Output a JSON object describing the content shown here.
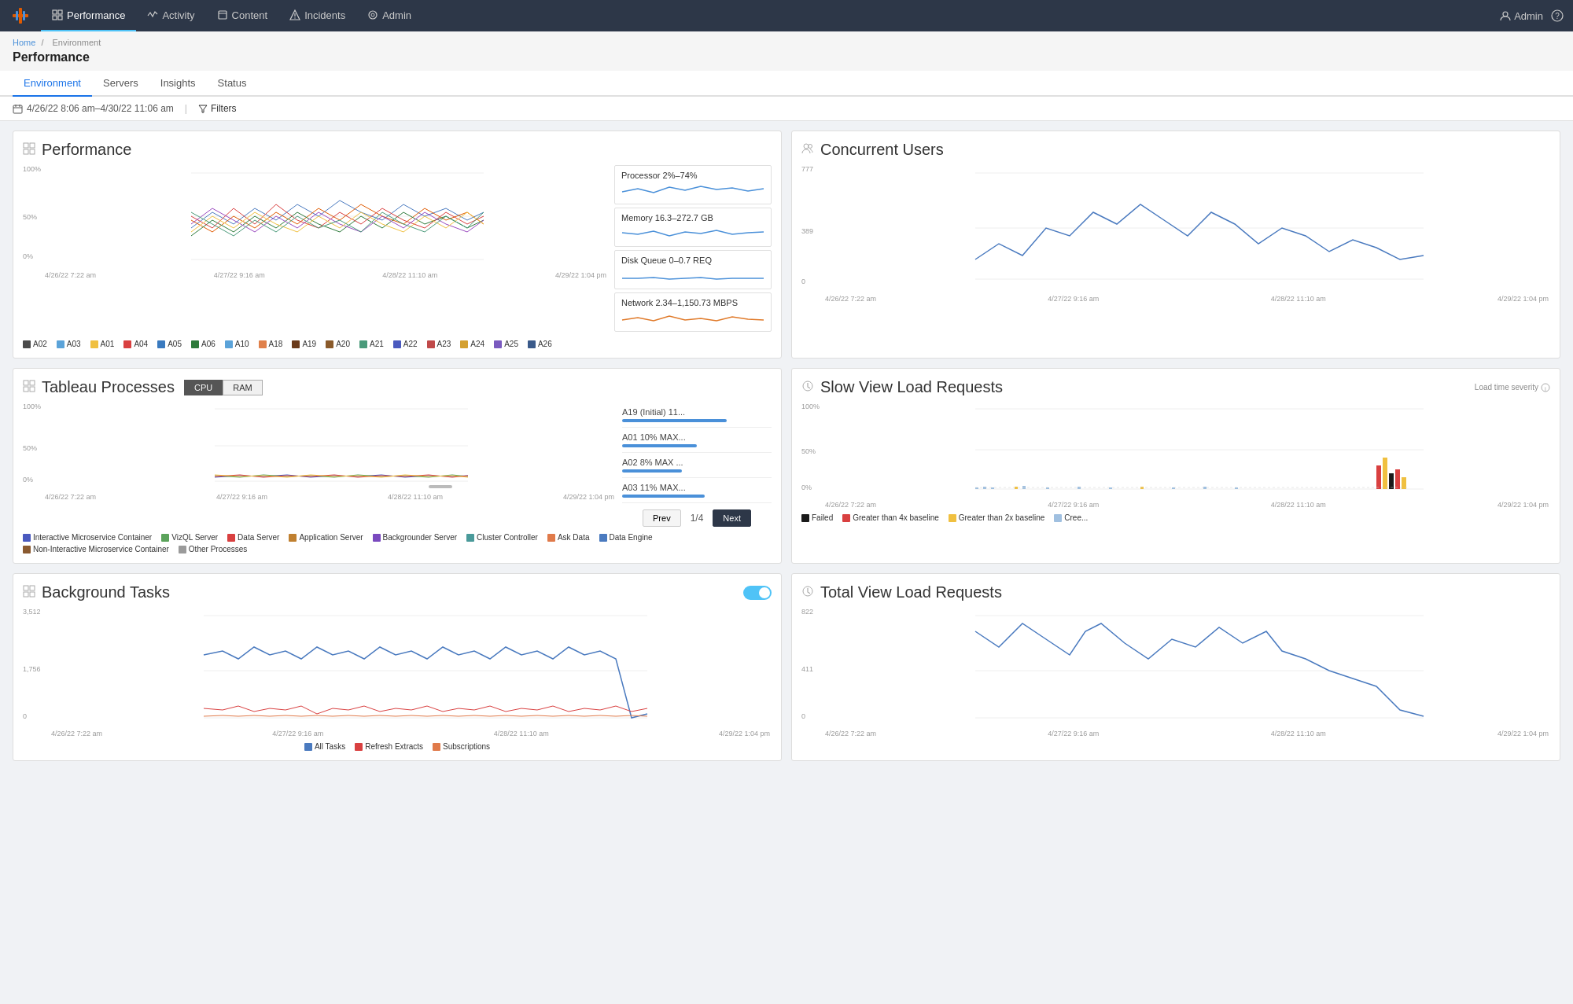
{
  "nav": {
    "logo_label": "Tableau",
    "items": [
      {
        "label": "Performance",
        "icon": "grid",
        "active": true
      },
      {
        "label": "Activity",
        "icon": "activity",
        "active": false
      },
      {
        "label": "Content",
        "icon": "content",
        "active": false
      },
      {
        "label": "Incidents",
        "icon": "alert",
        "active": false
      },
      {
        "label": "Admin",
        "icon": "gear",
        "active": false
      }
    ],
    "admin_label": "Admin",
    "help_icon": "?"
  },
  "breadcrumb": {
    "home": "Home",
    "separator": "/",
    "current": "Environment"
  },
  "page_title": "Performance",
  "tabs": [
    {
      "label": "Environment",
      "active": true
    },
    {
      "label": "Servers",
      "active": false
    },
    {
      "label": "Insights",
      "active": false
    },
    {
      "label": "Status",
      "active": false
    }
  ],
  "toolbar": {
    "date_range": "4/26/22 8:06 am–4/30/22 11:06 am",
    "divider": "|",
    "filter_label": "Filters"
  },
  "performance_card": {
    "title": "Performance",
    "y_labels": [
      "100%",
      "50%",
      "0%"
    ],
    "x_labels": [
      "4/26/22 7:22 am",
      "4/27/22 9:16 am",
      "4/28/22 11:10 am",
      "4/29/22 1:04 pm"
    ],
    "legend": [
      {
        "label": "A02",
        "color": "#4a4a4a"
      },
      {
        "label": "A03",
        "color": "#5ba3d9"
      },
      {
        "label": "A01",
        "color": "#f0c040"
      },
      {
        "label": "A04",
        "color": "#d94040"
      },
      {
        "label": "A05",
        "color": "#3a7abf"
      },
      {
        "label": "A06",
        "color": "#2d7a3a"
      },
      {
        "label": "A10",
        "color": "#5ba3d9"
      },
      {
        "label": "A18",
        "color": "#e0804a"
      },
      {
        "label": "A19",
        "color": "#6a3a1a"
      },
      {
        "label": "A20",
        "color": "#8a5a2a"
      },
      {
        "label": "A21",
        "color": "#4a9a7a"
      },
      {
        "label": "A22",
        "color": "#4a5abf"
      },
      {
        "label": "A23",
        "color": "#c04a4a"
      },
      {
        "label": "A24",
        "color": "#d4a030"
      },
      {
        "label": "A25",
        "color": "#7a5abf"
      },
      {
        "label": "A26",
        "color": "#3a5a8a"
      }
    ],
    "metrics": [
      {
        "label": "Processor 2%–74%",
        "color": "#4a90d9"
      },
      {
        "label": "Memory 16.3–272.7 GB",
        "color": "#4a90d9"
      },
      {
        "label": "Disk Queue 0–0.7 REQ",
        "color": "#4a90d9"
      },
      {
        "label": "Network 2.34–1,150.73 MBPS",
        "color": "#e07a2a"
      }
    ]
  },
  "concurrent_users_card": {
    "title": "Concurrent Users",
    "y_labels": [
      "777",
      "389",
      "0"
    ],
    "x_labels": [
      "4/26/22 7:22 am",
      "4/27/22 9:16 am",
      "4/28/22 11:10 am",
      "4/29/22 1:04 pm"
    ]
  },
  "tableau_processes_card": {
    "title": "Tableau Processes",
    "cpu_label": "CPU",
    "ram_label": "RAM",
    "y_labels": [
      "100%",
      "50%",
      "0%"
    ],
    "x_labels": [
      "4/26/22 7:22 am",
      "4/27/22 9:16 am",
      "4/28/22 11:10 am",
      "4/29/22 1:04 pm"
    ],
    "process_items": [
      {
        "label": "A19 (Initial) 11...",
        "pct": 70
      },
      {
        "label": "A01 10% MAX...",
        "pct": 50
      },
      {
        "label": "A02 8% MAX ...",
        "pct": 40
      },
      {
        "label": "A03 11% MAX...",
        "pct": 55
      }
    ],
    "pagination": {
      "prev_label": "Prev",
      "page_info": "1/4",
      "next_label": "Next"
    },
    "legend": [
      {
        "label": "Interactive Microservice Container",
        "color": "#4a5abf"
      },
      {
        "label": "VizQL Server",
        "color": "#5ba35b"
      },
      {
        "label": "Data Server",
        "color": "#d94040"
      },
      {
        "label": "Application Server",
        "color": "#c08030"
      },
      {
        "label": "Backgrounder Server",
        "color": "#7a4abf"
      },
      {
        "label": "Cluster Controller",
        "color": "#4a9a9a"
      },
      {
        "label": "Ask Data",
        "color": "#e07a4a"
      },
      {
        "label": "Data Engine",
        "color": "#4a7abf"
      },
      {
        "label": "Non-Interactive Microservice Container",
        "color": "#8a5a30"
      },
      {
        "label": "Other Processes",
        "color": "#9a9a9a"
      }
    ]
  },
  "slow_view_card": {
    "title": "Slow View Load Requests",
    "severity_label": "Load time severity",
    "y_labels": [
      "100%",
      "50%",
      "0%"
    ],
    "x_labels": [
      "4/26/22 7:22 am",
      "4/27/22 9:16 am",
      "4/28/22 11:10 am",
      "4/29/22 1:04 pm"
    ],
    "legend": [
      {
        "label": "Failed",
        "color": "#1a1a1a"
      },
      {
        "label": "Greater than 4x baseline",
        "color": "#d94040"
      },
      {
        "label": "Greater than 2x baseline",
        "color": "#f0c040"
      },
      {
        "label": "Cree...",
        "color": "#a0c0e0"
      }
    ]
  },
  "background_tasks_card": {
    "title": "Background Tasks",
    "toggle_on": true,
    "y_labels": [
      "3,512",
      "1,756",
      "0"
    ],
    "x_labels": [
      "4/26/22 7:22 am",
      "4/27/22 9:16 am",
      "4/28/22 11:10 am",
      "4/29/22 1:04 pm"
    ],
    "legend": [
      {
        "label": "All Tasks",
        "color": "#4a7abf"
      },
      {
        "label": "Refresh Extracts",
        "color": "#d94040"
      },
      {
        "label": "Subscriptions",
        "color": "#e07a4a"
      }
    ]
  },
  "total_view_card": {
    "title": "Total View Load Requests",
    "y_labels": [
      "822",
      "411",
      "0"
    ],
    "x_labels": [
      "4/26/22 7:22 am",
      "4/27/22 9:16 am",
      "4/28/22 11:10 am",
      "4/29/22 1:04 pm"
    ]
  }
}
